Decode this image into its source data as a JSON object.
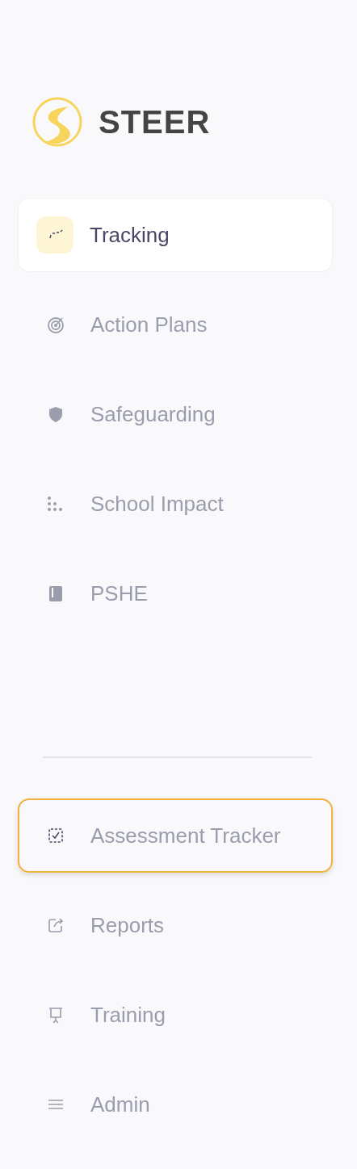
{
  "brand": {
    "name": "STEER"
  },
  "nav": [
    {
      "label": "Tracking",
      "selected": true
    },
    {
      "label": "Action Plans",
      "selected": false
    },
    {
      "label": "Safeguarding",
      "selected": false
    },
    {
      "label": "School Impact",
      "selected": false
    },
    {
      "label": "PSHE",
      "selected": false
    }
  ],
  "secondary_nav": [
    {
      "label": "Assessment Tracker",
      "selected": false,
      "highlighted": true
    },
    {
      "label": "Reports",
      "selected": false,
      "highlighted": false
    },
    {
      "label": "Training",
      "selected": false,
      "highlighted": false
    },
    {
      "label": "Admin",
      "selected": false,
      "highlighted": false
    }
  ]
}
